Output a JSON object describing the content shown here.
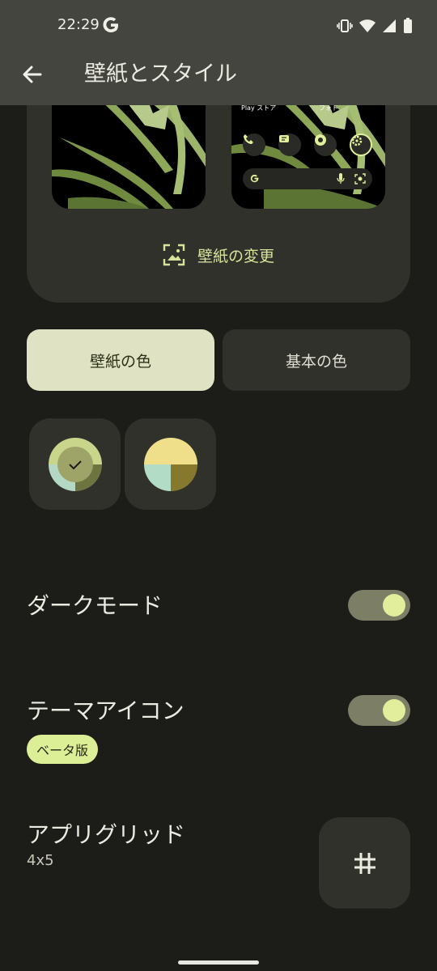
{
  "status_bar": {
    "time": "22:29",
    "icons": [
      "google-g-icon",
      "vibrate-icon",
      "wifi-icon",
      "cell-signal-icon",
      "battery-icon"
    ]
  },
  "app_bar": {
    "title": "壁紙とスタイル",
    "back_icon": "arrow-back-icon"
  },
  "wallpaper_preview": {
    "home_labels": {
      "left": "Play ストア",
      "right": "フォト"
    },
    "dock_icons": [
      "phone-icon",
      "messages-icon",
      "chrome-icon",
      "settings-icon"
    ],
    "search_icons": [
      "google-g-icon",
      "mic-icon",
      "lens-icon"
    ],
    "change_label": "壁紙の変更"
  },
  "color_tabs": {
    "wallpaper_colors": "壁紙の色",
    "basic_colors": "基本の色"
  },
  "swatches": [
    {
      "selected": true,
      "colors": [
        "#c8d58a",
        "#b4d8c4",
        "#6e7440",
        "#9ea468"
      ]
    },
    {
      "selected": false,
      "colors": [
        "#f0df8a",
        "#b2dcc6",
        "#86792e"
      ]
    }
  ],
  "settings": {
    "dark_mode": {
      "label": "ダークモード",
      "on": true
    },
    "themed_icons": {
      "label": "テーマアイコン",
      "badge": "ベータ版",
      "on": true
    },
    "app_grid": {
      "label": "アプリグリッド",
      "value": "4x5",
      "icon": "grid-hash-icon"
    }
  },
  "theme_colors": {
    "background": "#1c1c18",
    "app_bar": "#454540",
    "card": "#31312c",
    "accent": "#d8e39a",
    "toggle_track": "#7c7f66",
    "toggle_knob": "#e2ee9b"
  }
}
